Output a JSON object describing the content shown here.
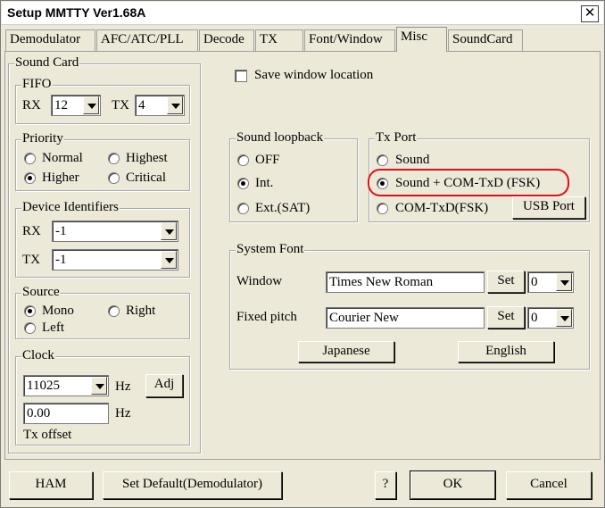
{
  "window": {
    "title": "Setup MMTTY Ver1.68A",
    "close_glyph": "✕"
  },
  "tabs": [
    {
      "label": "Demodulator"
    },
    {
      "label": "AFC/ATC/PLL"
    },
    {
      "label": "Decode"
    },
    {
      "label": "TX"
    },
    {
      "label": "Font/Window"
    },
    {
      "label": "Misc",
      "active": true
    },
    {
      "label": "SoundCard"
    }
  ],
  "sound_card": {
    "title": "Sound Card",
    "fifo": {
      "title": "FIFO",
      "rx_label": "RX",
      "rx_value": "12",
      "tx_label": "TX",
      "tx_value": "4"
    },
    "priority": {
      "title": "Priority",
      "options": [
        "Normal",
        "Highest",
        "Higher",
        "Critical"
      ],
      "selected": "Higher"
    },
    "device_identifiers": {
      "title": "Device Identifiers",
      "rx_label": "RX",
      "rx_value": "-1",
      "tx_label": "TX",
      "tx_value": "-1"
    },
    "source": {
      "title": "Source",
      "options": [
        "Mono",
        "Right",
        "Left"
      ],
      "selected": "Mono"
    },
    "clock": {
      "title": "Clock",
      "rate_value": "11025",
      "rate_unit": "Hz",
      "adj_label": "Adj",
      "offset_value": "0.00",
      "offset_unit": "Hz",
      "offset_label": "Tx offset"
    }
  },
  "save_window_location": {
    "label": "Save window location",
    "checked": false
  },
  "sound_loopback": {
    "title": "Sound loopback",
    "options": [
      "OFF",
      "Int.",
      "Ext.(SAT)"
    ],
    "selected": "Int."
  },
  "tx_port": {
    "title": "Tx Port",
    "options": [
      "Sound",
      "Sound + COM-TxD (FSK)",
      "COM-TxD(FSK)"
    ],
    "selected": "Sound + COM-TxD (FSK)",
    "usb_port_label": "USB Port",
    "highlight_color": "#e0101a"
  },
  "system_font": {
    "title": "System Font",
    "window_label": "Window",
    "window_font": "Times New Roman",
    "window_set": "Set",
    "window_charset": "0",
    "fixed_label": "Fixed pitch",
    "fixed_font": "Courier New",
    "fixed_set": "Set",
    "fixed_charset": "0",
    "japanese_label": "Japanese",
    "english_label": "English"
  },
  "bottom": {
    "ham": "HAM",
    "set_default": "Set Default(Demodulator)",
    "help": "?",
    "ok": "OK",
    "cancel": "Cancel"
  }
}
